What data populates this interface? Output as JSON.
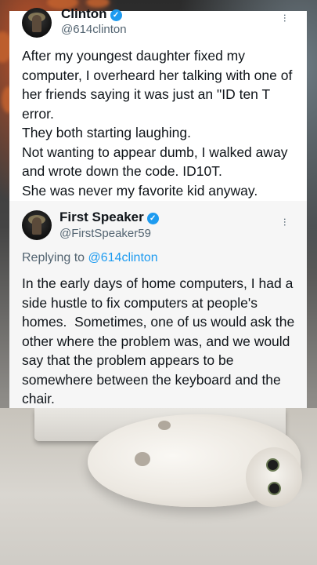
{
  "tweet1": {
    "name": "Clinton",
    "handle": "@614clinton",
    "text": "After my youngest daughter fixed my computer, I overheard her talking with one of her friends saying it was just an \"ID ten T error.\nThey both starting laughing.\nNot wanting to appear dumb, I walked away and wrote down the code. ID10T.\nShe was never my favorite kid anyway."
  },
  "tweet2": {
    "name": "First Speaker",
    "handle": "@FirstSpeaker59",
    "replying_prefix": "Replying to",
    "replying_to": "@614clinton",
    "text": "In the early days of home computers, I had a side hustle to fix computers at people's homes.  Sometimes, one of us would ask the other where the problem was, and we would say that the problem appears to be somewhere between the keyboard and the chair."
  },
  "icons": {
    "verified": "✓",
    "more": "···"
  },
  "colors": {
    "verified": "#1d9bf0",
    "link": "#1d9bf0",
    "secondary_text": "#536471"
  }
}
